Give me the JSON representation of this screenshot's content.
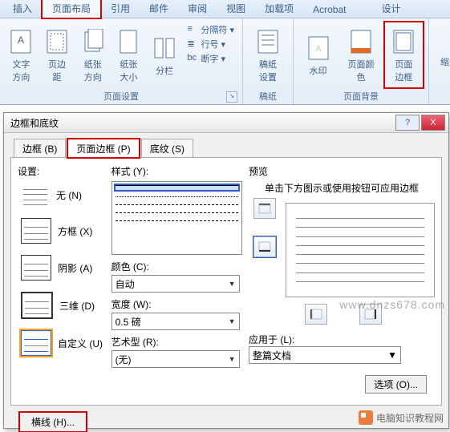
{
  "ribbon": {
    "tabs": {
      "insert": "插入",
      "page_layout": "页面布局",
      "references": "引用",
      "mailings": "邮件",
      "review": "审阅",
      "view": "视图",
      "addins": "加载项",
      "acrobat": "Acrobat",
      "design": "设计"
    },
    "groups": {
      "page_setup": {
        "label": "页面设置",
        "text_direction": "文字方向",
        "margins": "页边距",
        "orientation": "纸张方向",
        "size": "纸张大小",
        "columns": "分栏",
        "breaks": "分隔符",
        "line_numbers": "行号",
        "hyphenation": "断字"
      },
      "manuscript": {
        "label": "稿纸",
        "manuscript_settings": "稿纸\n设置"
      },
      "page_background": {
        "label": "页面背景",
        "watermark": "水印",
        "page_color": "页面颜色",
        "page_borders": "页面\n边框"
      },
      "indent": {
        "label": "缩进"
      }
    }
  },
  "dialog": {
    "title": "边框和底纹",
    "help": "?",
    "close": "X",
    "tabs": {
      "border": "边框 (B)",
      "page_border": "页面边框 (P)",
      "shading": "底纹 (S)"
    },
    "setting": {
      "label": "设置:",
      "none": "无 (N)",
      "box": "方框 (X)",
      "shadow": "阴影 (A)",
      "three_d": "三维 (D)",
      "custom": "自定义 (U)"
    },
    "style": {
      "label": "样式 (Y):",
      "color_label": "颜色 (C):",
      "color_value": "自动",
      "width_label": "宽度 (W):",
      "width_value": "0.5 磅",
      "art_label": "艺术型 (R):",
      "art_value": "(无)"
    },
    "preview": {
      "label": "预览",
      "hint": "单击下方图示或使用按钮可应用边框",
      "apply_label": "应用于 (L):",
      "apply_value": "整篇文档",
      "options_btn": "选项 (O)..."
    },
    "hline_btn": "横线 (H)..."
  },
  "watermark": {
    "text": "电脑知识教程网",
    "url": "www.dnzs678.com"
  }
}
